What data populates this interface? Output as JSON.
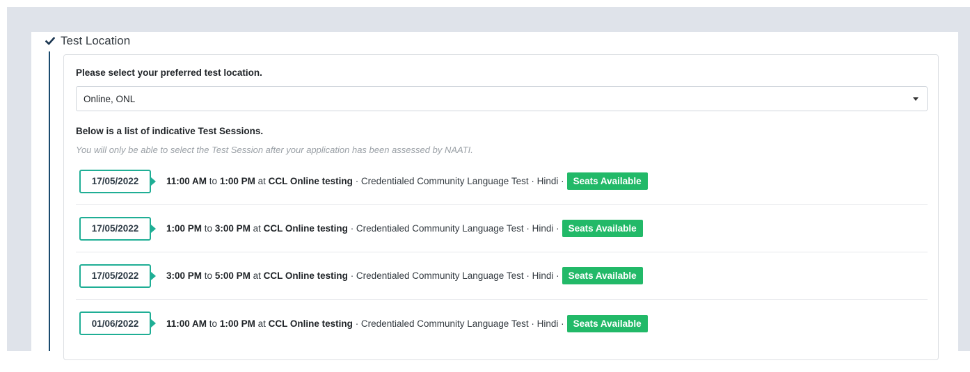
{
  "step": {
    "title": "Test Location",
    "icon": "check-icon"
  },
  "location": {
    "label": "Please select your preferred test location.",
    "selected": "Online, ONL"
  },
  "sessions": {
    "heading": "Below is a list of indicative Test Sessions.",
    "note": "You will only be able to select the Test Session after your application has been assessed by NAATI.",
    "items": [
      {
        "date": "17/05/2022",
        "start": "11:00 AM",
        "to": "to",
        "end": "1:00 PM",
        "at": "at",
        "venue": "CCL Online testing",
        "details": "· Credentialed Community Language Test · Hindi ·",
        "badge": "Seats Available"
      },
      {
        "date": "17/05/2022",
        "start": "1:00 PM",
        "to": "to",
        "end": "3:00 PM",
        "at": "at",
        "venue": "CCL Online testing",
        "details": "· Credentialed Community Language Test · Hindi ·",
        "badge": "Seats Available"
      },
      {
        "date": "17/05/2022",
        "start": "3:00 PM",
        "to": "to",
        "end": "5:00 PM",
        "at": "at",
        "venue": "CCL Online testing",
        "details": "· Credentialed Community Language Test · Hindi ·",
        "badge": "Seats Available"
      },
      {
        "date": "01/06/2022",
        "start": "11:00 AM",
        "to": "to",
        "end": "1:00 PM",
        "at": "at",
        "venue": "CCL Online testing",
        "details": "· Credentialed Community Language Test · Hindi ·",
        "badge": "Seats Available"
      }
    ]
  },
  "colors": {
    "accent": "#1fae95",
    "badge": "#22b968",
    "step_line": "#1a4a6e"
  }
}
